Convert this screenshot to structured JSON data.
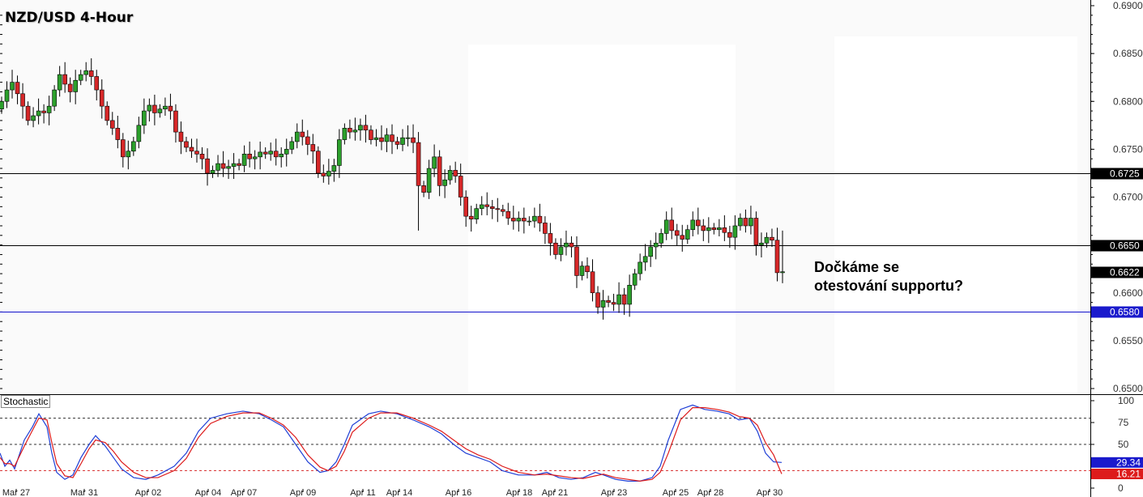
{
  "title": "NZD/USD 4-Hour",
  "annotation": "Dočkáme se\notestování supportu?",
  "indicator_label": "Stochastic",
  "colors": {
    "bull": "#2ca02c",
    "bear": "#d62728",
    "wick": "#000000",
    "level_line": "#000000",
    "support_line": "#1010cc",
    "stoch_k": "#1f3fd6",
    "stoch_d": "#dd1b1b",
    "price_tag": "#000000",
    "support_tag": "#1a1acc",
    "k_tag": "#1a1acc",
    "d_tag": "#dd1b1b"
  },
  "chart_data": [
    {
      "type": "candlestick",
      "title": "NZD/USD 4-Hour",
      "ylim": [
        0.6495,
        0.6905
      ],
      "y_ticks": [
        "0.6900",
        "0.6850",
        "0.6800",
        "0.6750",
        "0.6700",
        "0.6650",
        "0.6600",
        "0.6550",
        "0.6500"
      ],
      "x_ticks": [
        "Mar 27",
        "Mar 31",
        "Apr 02",
        "Apr 04",
        "Apr 07",
        "Apr 09",
        "Apr 11",
        "Apr 14",
        "Apr 16",
        "Apr 18",
        "Apr 21",
        "Apr 23",
        "Apr 25",
        "Apr 28",
        "Apr 30"
      ],
      "horizontal_levels": [
        {
          "value": 0.6725,
          "label": "0.6725",
          "kind": "resistance"
        },
        {
          "value": 0.665,
          "label": "0.6650",
          "kind": "level"
        },
        {
          "value": 0.658,
          "label": "0.6580",
          "kind": "support"
        }
      ],
      "last_price": {
        "value": 0.6622,
        "label": "0.6622"
      },
      "closes": [
        0.68,
        0.6812,
        0.682,
        0.6808,
        0.6795,
        0.678,
        0.6785,
        0.679,
        0.6788,
        0.6795,
        0.6812,
        0.6828,
        0.6818,
        0.681,
        0.6822,
        0.6828,
        0.6832,
        0.6826,
        0.6812,
        0.6795,
        0.678,
        0.6772,
        0.676,
        0.6742,
        0.6748,
        0.6758,
        0.6775,
        0.679,
        0.6796,
        0.6788,
        0.6792,
        0.6795,
        0.679,
        0.6768,
        0.6758,
        0.6752,
        0.6748,
        0.6745,
        0.674,
        0.6725,
        0.6728,
        0.6735,
        0.673,
        0.6732,
        0.6735,
        0.6733,
        0.6745,
        0.674,
        0.6742,
        0.6747,
        0.6745,
        0.6748,
        0.6742,
        0.6745,
        0.675,
        0.6758,
        0.6768,
        0.6763,
        0.6755,
        0.6748,
        0.6725,
        0.6722,
        0.6727,
        0.6733,
        0.676,
        0.6772,
        0.6768,
        0.677,
        0.6775,
        0.677,
        0.676,
        0.6762,
        0.6758,
        0.6765,
        0.6758,
        0.6755,
        0.6762,
        0.6762,
        0.6757,
        0.6712,
        0.6705,
        0.673,
        0.6742,
        0.6712,
        0.6718,
        0.6728,
        0.6722,
        0.67,
        0.668,
        0.6677,
        0.6688,
        0.6692,
        0.669,
        0.6688,
        0.6687,
        0.6685,
        0.6678,
        0.6675,
        0.6678,
        0.6675,
        0.6675,
        0.668,
        0.6673,
        0.6662,
        0.6652,
        0.664,
        0.6648,
        0.6652,
        0.6648,
        0.6618,
        0.6628,
        0.6622,
        0.66,
        0.6585,
        0.6592,
        0.659,
        0.6588,
        0.6598,
        0.6588,
        0.6608,
        0.662,
        0.6632,
        0.6638,
        0.6648,
        0.6652,
        0.6662,
        0.6676,
        0.6665,
        0.666,
        0.6656,
        0.6666,
        0.6676,
        0.667,
        0.6665,
        0.6668,
        0.6666,
        0.6668,
        0.6663,
        0.6658,
        0.667,
        0.6678,
        0.667,
        0.6678,
        0.665,
        0.6652,
        0.6658,
        0.6655,
        0.6621,
        0.6622
      ]
    },
    {
      "type": "line",
      "title": "Stochastic",
      "ylim": [
        0,
        100
      ],
      "y_ticks": [
        "100",
        "75",
        "50",
        "0"
      ],
      "levels": [
        80,
        50,
        20
      ],
      "series": [
        {
          "name": "%K",
          "last": 29.34,
          "last_label": "29.34",
          "points": [
            [
              0,
              40
            ],
            [
              6,
              25
            ],
            [
              12,
              32
            ],
            [
              18,
              22
            ],
            [
              30,
              55
            ],
            [
              40,
              70
            ],
            [
              48,
              85
            ],
            [
              58,
              70
            ],
            [
              64,
              40
            ],
            [
              70,
              18
            ],
            [
              80,
              10
            ],
            [
              90,
              15
            ],
            [
              100,
              35
            ],
            [
              110,
              50
            ],
            [
              118,
              60
            ],
            [
              130,
              48
            ],
            [
              140,
              35
            ],
            [
              150,
              22
            ],
            [
              165,
              12
            ],
            [
              180,
              10
            ],
            [
              195,
              15
            ],
            [
              215,
              25
            ],
            [
              230,
              40
            ],
            [
              245,
              65
            ],
            [
              260,
              80
            ],
            [
              280,
              85
            ],
            [
              300,
              88
            ],
            [
              320,
              85
            ],
            [
              335,
              78
            ],
            [
              350,
              70
            ],
            [
              365,
              50
            ],
            [
              380,
              30
            ],
            [
              395,
              18
            ],
            [
              405,
              20
            ],
            [
              415,
              30
            ],
            [
              425,
              50
            ],
            [
              435,
              72
            ],
            [
              455,
              85
            ],
            [
              470,
              88
            ],
            [
              490,
              85
            ],
            [
              510,
              78
            ],
            [
              530,
              70
            ],
            [
              545,
              62
            ],
            [
              560,
              50
            ],
            [
              575,
              40
            ],
            [
              590,
              35
            ],
            [
              605,
              30
            ],
            [
              620,
              20
            ],
            [
              640,
              15
            ],
            [
              660,
              15
            ],
            [
              675,
              18
            ],
            [
              690,
              12
            ],
            [
              705,
              10
            ],
            [
              720,
              12
            ],
            [
              735,
              18
            ],
            [
              745,
              15
            ],
            [
              760,
              10
            ],
            [
              775,
              8
            ],
            [
              790,
              8
            ],
            [
              805,
              12
            ],
            [
              815,
              25
            ],
            [
              825,
              55
            ],
            [
              840,
              90
            ],
            [
              855,
              95
            ],
            [
              870,
              90
            ],
            [
              885,
              88
            ],
            [
              900,
              85
            ],
            [
              912,
              78
            ],
            [
              925,
              80
            ],
            [
              935,
              65
            ],
            [
              945,
              40
            ],
            [
              955,
              30
            ],
            [
              965,
              29.34
            ]
          ]
        },
        {
          "name": "%D",
          "last": 16.21,
          "last_label": "16.21",
          "points": [
            [
              0,
              35
            ],
            [
              6,
              28
            ],
            [
              12,
              28
            ],
            [
              18,
              25
            ],
            [
              30,
              48
            ],
            [
              40,
              66
            ],
            [
              48,
              80
            ],
            [
              58,
              78
            ],
            [
              64,
              52
            ],
            [
              70,
              28
            ],
            [
              80,
              14
            ],
            [
              90,
              12
            ],
            [
              100,
              28
            ],
            [
              110,
              45
            ],
            [
              118,
              55
            ],
            [
              130,
              52
            ],
            [
              140,
              42
            ],
            [
              150,
              30
            ],
            [
              165,
              18
            ],
            [
              180,
              12
            ],
            [
              195,
              12
            ],
            [
              215,
              20
            ],
            [
              230,
              34
            ],
            [
              245,
              58
            ],
            [
              260,
              74
            ],
            [
              280,
              82
            ],
            [
              300,
              86
            ],
            [
              320,
              86
            ],
            [
              335,
              80
            ],
            [
              350,
              72
            ],
            [
              365,
              58
            ],
            [
              380,
              38
            ],
            [
              395,
              24
            ],
            [
              405,
              20
            ],
            [
              415,
              25
            ],
            [
              425,
              42
            ],
            [
              435,
              64
            ],
            [
              455,
              80
            ],
            [
              470,
              86
            ],
            [
              490,
              86
            ],
            [
              510,
              80
            ],
            [
              530,
              72
            ],
            [
              545,
              65
            ],
            [
              560,
              55
            ],
            [
              575,
              45
            ],
            [
              590,
              38
            ],
            [
              605,
              33
            ],
            [
              620,
              25
            ],
            [
              640,
              18
            ],
            [
              660,
              15
            ],
            [
              675,
              16
            ],
            [
              690,
              14
            ],
            [
              705,
              12
            ],
            [
              720,
              11
            ],
            [
              735,
              14
            ],
            [
              745,
              16
            ],
            [
              760,
              12
            ],
            [
              775,
              10
            ],
            [
              790,
              8
            ],
            [
              805,
              10
            ],
            [
              815,
              18
            ],
            [
              825,
              40
            ],
            [
              840,
              78
            ],
            [
              855,
              92
            ],
            [
              870,
              92
            ],
            [
              885,
              90
            ],
            [
              900,
              87
            ],
            [
              912,
              82
            ],
            [
              925,
              80
            ],
            [
              935,
              72
            ],
            [
              945,
              52
            ],
            [
              955,
              38
            ],
            [
              965,
              16.21
            ]
          ]
        }
      ]
    }
  ]
}
